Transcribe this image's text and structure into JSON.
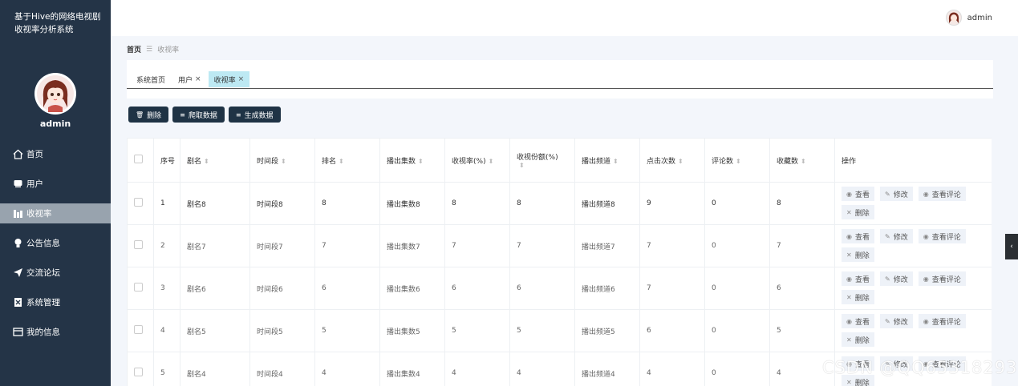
{
  "app": {
    "title": "基于Hive的网络电视剧收视率分析系统"
  },
  "sidebar": {
    "username": "admin",
    "items": [
      {
        "label": "首页",
        "icon": "home-icon"
      },
      {
        "label": "用户",
        "icon": "user-icon"
      },
      {
        "label": "收视率",
        "icon": "chart-icon"
      },
      {
        "label": "公告信息",
        "icon": "bulb-icon"
      },
      {
        "label": "交流论坛",
        "icon": "send-icon"
      },
      {
        "label": "系统管理",
        "icon": "doc-icon"
      },
      {
        "label": "我的信息",
        "icon": "card-icon"
      }
    ]
  },
  "header": {
    "username": "admin"
  },
  "breadcrumb": {
    "home": "首页",
    "current": "收视率"
  },
  "tabs": [
    {
      "label": "系统首页"
    },
    {
      "label": "用户"
    },
    {
      "label": "收视率"
    }
  ],
  "toolbar": {
    "delete_label": "删除",
    "crawl_label": "爬取数据",
    "generate_label": "生成数据"
  },
  "table": {
    "headers": [
      "序号",
      "剧名",
      "时间段",
      "排名",
      "播出集数",
      "收视率(%)",
      "收视份额(%)",
      "播出频道",
      "点击次数",
      "评论数",
      "收藏数",
      "操作"
    ],
    "rows": [
      [
        "1",
        "剧名8",
        "时间段8",
        "8",
        "播出集数8",
        "8",
        "8",
        "播出频道8",
        "9",
        "0",
        "8"
      ],
      [
        "2",
        "剧名7",
        "时间段7",
        "7",
        "播出集数7",
        "7",
        "7",
        "播出频道7",
        "7",
        "0",
        "7"
      ],
      [
        "3",
        "剧名6",
        "时间段6",
        "6",
        "播出集数6",
        "6",
        "6",
        "播出频道6",
        "7",
        "0",
        "6"
      ],
      [
        "4",
        "剧名5",
        "时间段5",
        "5",
        "播出集数5",
        "5",
        "5",
        "播出频道5",
        "6",
        "0",
        "5"
      ],
      [
        "5",
        "剧名4",
        "时间段4",
        "4",
        "播出集数4",
        "4",
        "4",
        "播出频道4",
        "4",
        "0",
        "4"
      ]
    ],
    "ops": {
      "view": "查看",
      "edit": "修改",
      "comments": "查看评论",
      "delete": "删除"
    }
  },
  "watermark": "CSDN @QQ65318293",
  "colors": {
    "sidebar_bg": "#243447",
    "active_menu": "#98a3ae",
    "button_bg": "#1f3345",
    "active_tab": "#bde9f3"
  }
}
